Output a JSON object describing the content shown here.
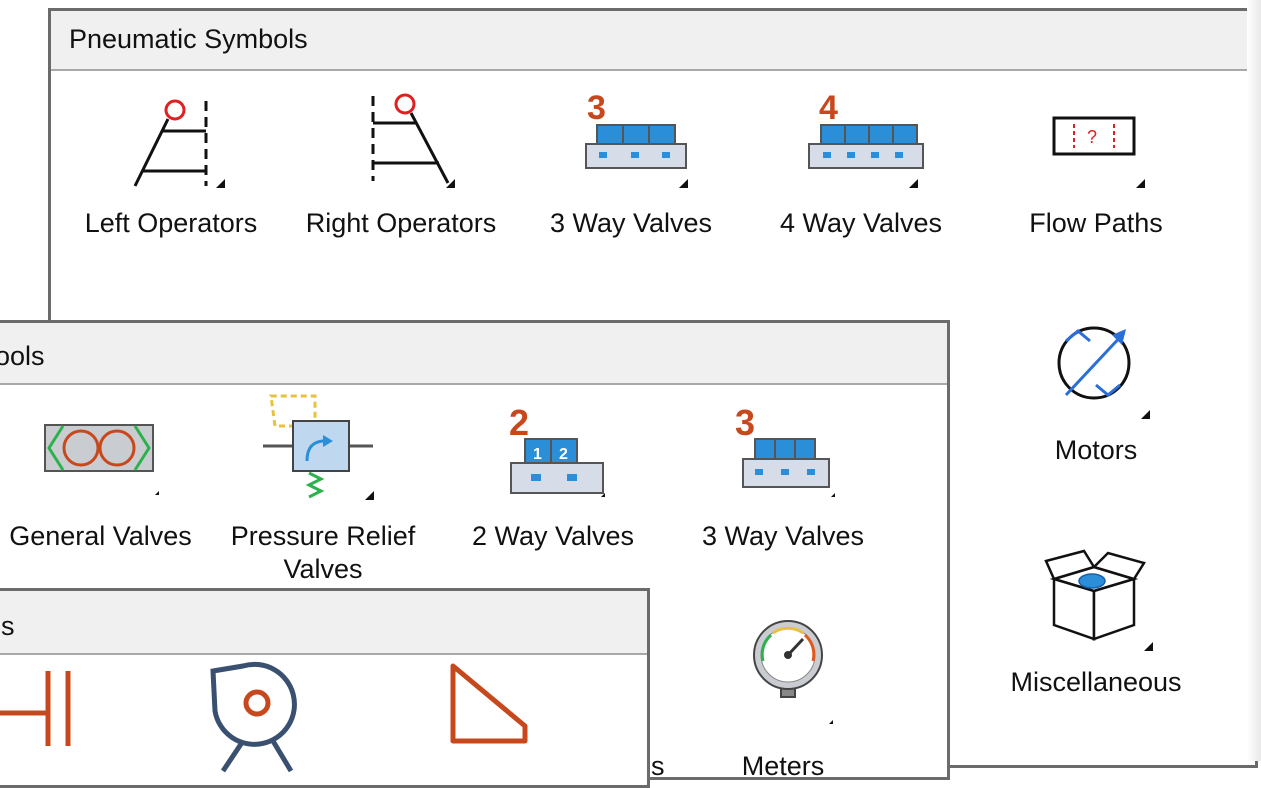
{
  "panels": {
    "pneumatic": {
      "title": "Pneumatic Symbols",
      "items": [
        {
          "label": "Left Operators",
          "icon": "left-operators-icon"
        },
        {
          "label": "Right Operators",
          "icon": "right-operators-icon"
        },
        {
          "label": "3 Way Valves",
          "icon": "three-way-valve-icon",
          "badge": "3"
        },
        {
          "label": "4 Way Valves",
          "icon": "four-way-valve-icon",
          "badge": "4"
        },
        {
          "label": "Flow Paths",
          "icon": "flow-paths-icon"
        },
        {
          "label": "Motors",
          "icon": "motor-icon"
        },
        {
          "label": "Miscellaneous",
          "icon": "box-icon"
        }
      ]
    },
    "middle": {
      "title": "ools",
      "items": [
        {
          "label": "General Valves",
          "icon": "general-valve-icon"
        },
        {
          "label": "Pressure Relief",
          "label2": "Valves",
          "icon": "pressure-relief-valve-icon"
        },
        {
          "label": "2 Way Valves",
          "icon": "two-way-valve-icon",
          "badge": "2"
        },
        {
          "label": "3 Way Valves",
          "icon": "three-way-valve-icon",
          "badge": "3"
        },
        {
          "label": "Meters",
          "icon": "gauge-icon"
        },
        {
          "label": "s",
          "icon": ""
        }
      ]
    },
    "front": {
      "title": "ls",
      "items": [
        {
          "icon": "capacitor-icon"
        },
        {
          "icon": "pump-icon"
        },
        {
          "icon": "triangle-shape-icon"
        }
      ]
    }
  },
  "colors": {
    "accent_red": "#c8481e",
    "valve_blue": "#2a8fd8",
    "border_gray": "#6b6b6b"
  }
}
